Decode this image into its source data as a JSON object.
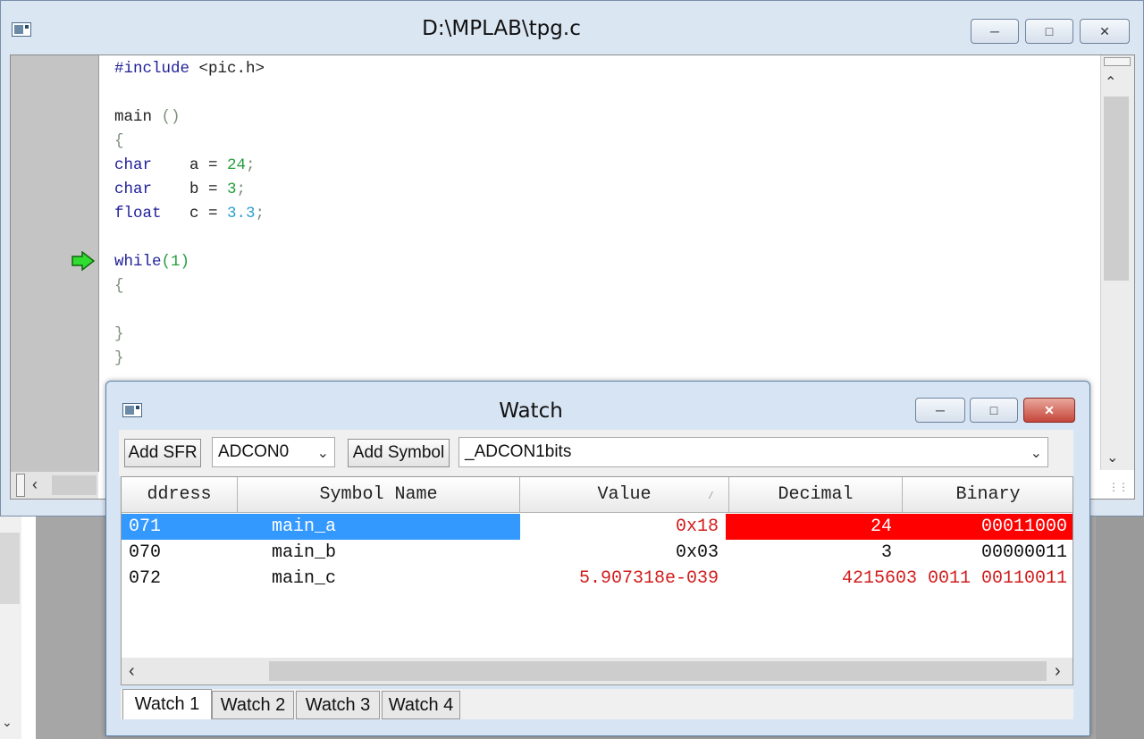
{
  "editor": {
    "title": "D:\\MPLAB\\tpg.c",
    "code": {
      "line1_kw": "#include",
      "line1_rest": " <pic.h>",
      "line2_main": "main",
      "line2_paren": " ()",
      "brace_open": "{",
      "decl1_type": "char",
      "decl1_var": "    a = ",
      "decl1_val": "24",
      "decl1_end": ";",
      "decl2_type": "char",
      "decl2_var": "    b = ",
      "decl2_val": "3",
      "decl2_end": ";",
      "decl3_type": "float",
      "decl3_var": "   c = ",
      "decl3_val": "3.3",
      "decl3_end": ";",
      "while_kw": "while",
      "while_cond": "(1)",
      "inner_open": "{",
      "inner_close": "}",
      "brace_close": "}"
    }
  },
  "watch": {
    "title": "Watch",
    "toolbar": {
      "add_sfr_label": "Add SFR",
      "sfr_selected": "ADCON0",
      "add_symbol_label": "Add Symbol",
      "symbol_selected": "_ADCON1bits"
    },
    "columns": {
      "address": "ddress",
      "symbol_name": "Symbol Name",
      "value": "Value",
      "decimal": "Decimal",
      "binary": "Binary"
    },
    "rows": [
      {
        "address": "071",
        "symbol": "main_a",
        "value": "0x18",
        "decimal": "24",
        "binary": "00011000"
      },
      {
        "address": "070",
        "symbol": "main_b",
        "value": "0x03",
        "decimal": "3",
        "binary": "00000011"
      },
      {
        "address": "072",
        "symbol": "main_c",
        "value": "5.907318e-039",
        "decimal": "4215603",
        "binary": "0011 00110011"
      }
    ],
    "tabs": [
      "Watch 1",
      "Watch 2",
      "Watch 3",
      "Watch 4"
    ]
  },
  "icons": {
    "current_line_marker": "green-arrow-icon"
  },
  "colors": {
    "selection_blue": "#3399ff",
    "changed_red": "#ff0000",
    "code_keyword": "#1f1f9a",
    "code_number": "#219f3c",
    "close_button": "#c6453a"
  }
}
